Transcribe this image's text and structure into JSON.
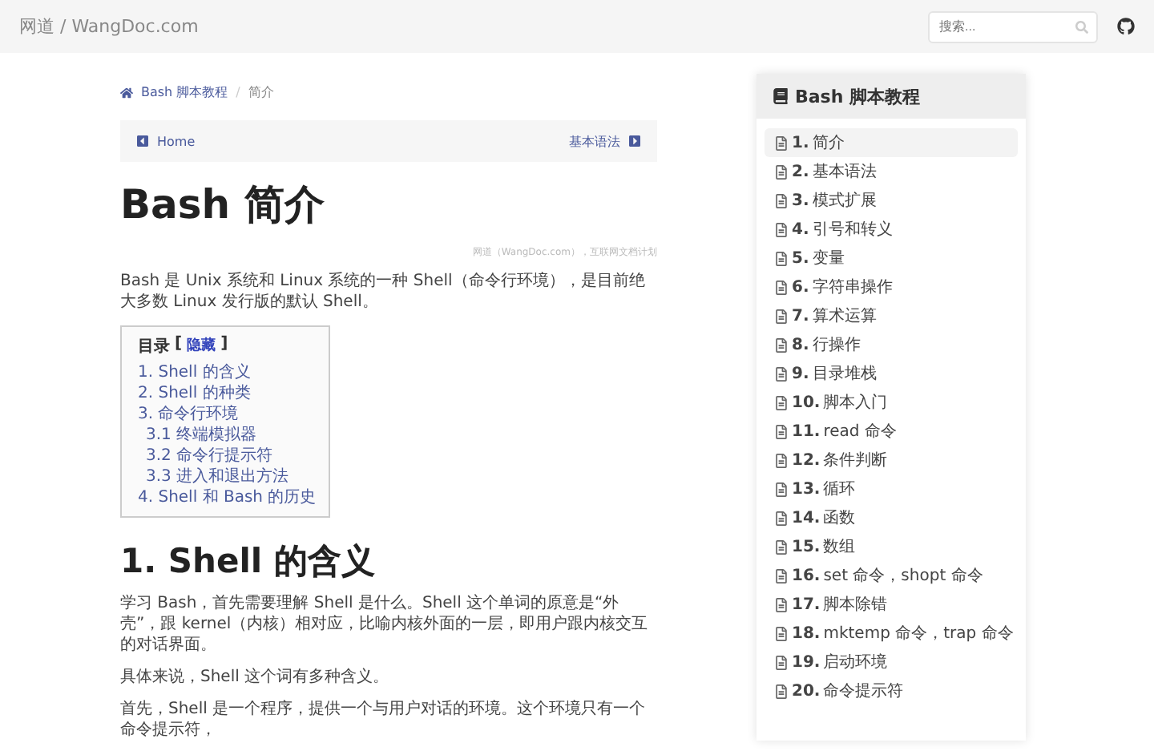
{
  "header": {
    "site": "网道 / WangDoc.com",
    "search": {
      "placeholder": "搜索..."
    }
  },
  "breadcrumb": [
    "Bash 脚本教程",
    "简介"
  ],
  "breadcrumb_separator": "/",
  "pager": {
    "prev": "Home",
    "next": "基本语法"
  },
  "title": "Bash 简介",
  "source": "网道（WangDoc.com），互联网文档计划",
  "intro": "Bash 是 Unix 系统和 Linux 系统的一种 Shell（命令行环境），是目前绝大多数 Linux 发行版的默认 Shell。",
  "toc": {
    "heading": "目录",
    "bracket_open": "[",
    "toggle": "隐藏",
    "bracket_close": "]",
    "items": [
      {
        "label": "1. Shell 的含义"
      },
      {
        "label": "2. Shell 的种类"
      },
      {
        "label": "3. 命令行环境",
        "children": [
          {
            "label": "3.1 终端模拟器"
          },
          {
            "label": "3.2 命令行提示符"
          },
          {
            "label": "3.3 进入和退出方法"
          }
        ]
      },
      {
        "label": "4. Shell 和 Bash 的历史"
      }
    ]
  },
  "section": {
    "heading": "1. Shell 的含义",
    "paragraphs": [
      "学习 Bash，首先需要理解 Shell 是什么。Shell 这个单词的原意是“外壳”，跟 kernel（内核）相对应，比喻内核外面的一层，即用户跟内核交互的对话界面。",
      "具体来说，Shell 这个词有多种含义。",
      "首先，Shell 是一个程序，提供一个与用户对话的环境。这个环境只有一个命令提示符，"
    ]
  },
  "sidebar": {
    "title": "Bash 脚本教程",
    "items": [
      {
        "number": "1.",
        "label": "简介",
        "selected": true
      },
      {
        "number": "2.",
        "label": "基本语法",
        "selected": false
      },
      {
        "number": "3.",
        "label": "模式扩展",
        "selected": false
      },
      {
        "number": "4.",
        "label": "引号和转义",
        "selected": false
      },
      {
        "number": "5.",
        "label": "变量",
        "selected": false
      },
      {
        "number": "6.",
        "label": "字符串操作",
        "selected": false
      },
      {
        "number": "7.",
        "label": "算术运算",
        "selected": false
      },
      {
        "number": "8.",
        "label": "行操作",
        "selected": false
      },
      {
        "number": "9.",
        "label": "目录堆栈",
        "selected": false
      },
      {
        "number": "10.",
        "label": "脚本入门",
        "selected": false
      },
      {
        "number": "11.",
        "label": "read 命令",
        "selected": false
      },
      {
        "number": "12.",
        "label": "条件判断",
        "selected": false
      },
      {
        "number": "13.",
        "label": "循环",
        "selected": false
      },
      {
        "number": "14.",
        "label": "函数",
        "selected": false
      },
      {
        "number": "15.",
        "label": "数组",
        "selected": false
      },
      {
        "number": "16.",
        "label": "set 命令，shopt 命令",
        "selected": false
      },
      {
        "number": "17.",
        "label": "脚本除错",
        "selected": false
      },
      {
        "number": "18.",
        "label": "mktemp 命令，trap 命令",
        "selected": false
      },
      {
        "number": "19.",
        "label": "启动环境",
        "selected": false
      },
      {
        "number": "20.",
        "label": "命令提示符",
        "selected": false
      }
    ]
  }
}
